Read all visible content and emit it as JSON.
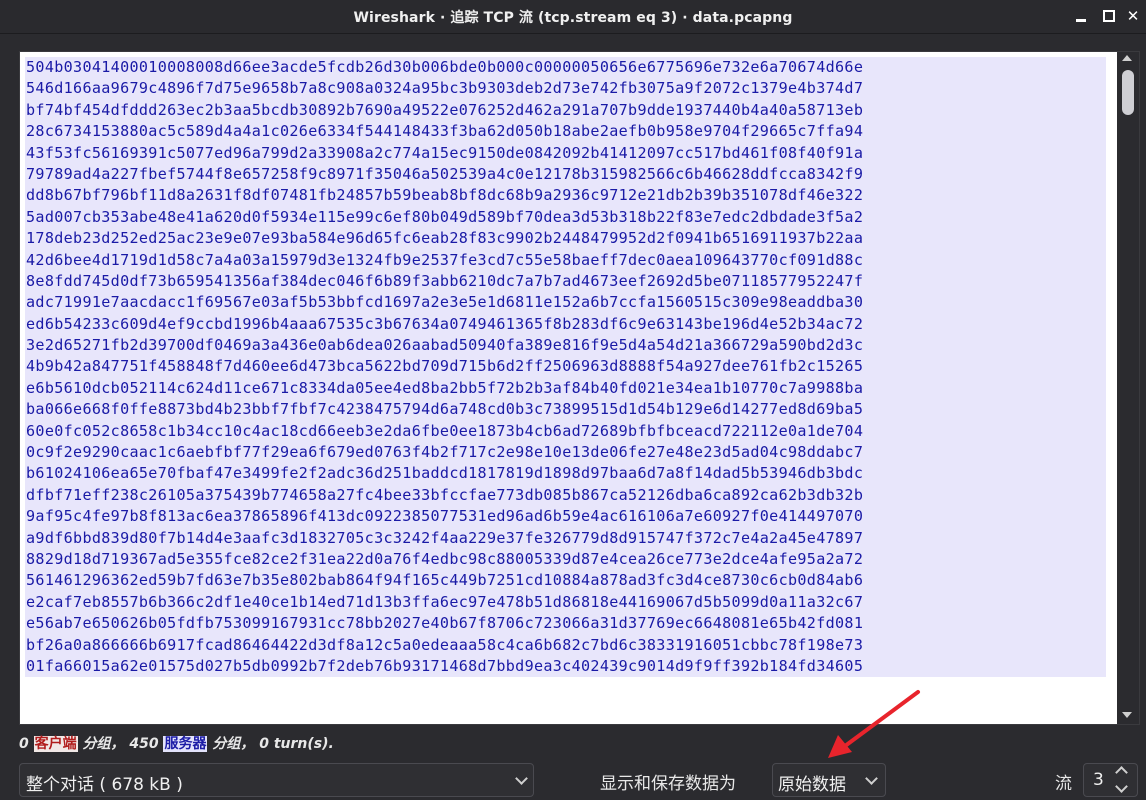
{
  "window": {
    "title": "Wireshark · 追踪 TCP 流 (tcp.stream eq 3) · data.pcapng",
    "min_glyph": "—",
    "max_glyph": "□",
    "close_glyph": "✕"
  },
  "stream": {
    "lines": [
      "504b03041400010008008d66ee3acde5fcdb26d30b006bde0b000c00000050656e6775696e732e6a70674d66e",
      "546d166aa9679c4896f7d75e9658b7a8c908a0324a95bc3b9303deb2d73e742fb3075a9f2072c1379e4b374d7",
      "bf74bf454dfddd263ec2b3aa5bcdb30892b7690a49522e076252d462a291a707b9dde1937440b4a40a58713eb",
      "28c6734153880ac5c589d4a4a1c026e6334f544148433f3ba62d050b18abe2aefb0b958e9704f29665c7ffa94",
      "43f53fc56169391c5077ed96a799d2a33908a2c774a15ec9150de0842092b41412097cc517bd461f08f40f91a",
      "79789ad4a227fbef5744f8e657258f9c8971f35046a502539a4c0e12178b315982566c6b46628ddfcca8342f9",
      "dd8b67bf796bf11d8a2631f8df07481fb24857b59beab8bf8dc68b9a2936c9712e21db2b39b351078df46e322",
      "5ad007cb353abe48e41a620d0f5934e115e99c6ef80b049d589bf70dea3d53b318b22f83e7edc2dbdade3f5a2",
      "178deb23d252ed25ac23e9e07e93ba584e96d65fc6eab28f83c9902b2448479952d2f0941b6516911937b22aa",
      "42d6bee4d1719d1d58c7a4a03a15979d3e1324fb9e2537fe3cd7c55e58baeff7dec0aea109643770cf091d88c",
      "8e8fdd745d0df73b659541356af384dec046f6b89f3abb6210dc7a7b7ad4673eef2692d5be07118577952247f",
      "adc71991e7aacdacc1f69567e03af5b53bbfcd1697a2e3e5e1d6811e152a6b7ccfa1560515c309e98eaddba30",
      "ed6b54233c609d4ef9ccbd1996b4aaa67535c3b67634a0749461365f8b283df6c9e63143be196d4e52b34ac72",
      "3e2d65271fb2d39700df0469a3a436e0ab6dea026aabad50940fa389e816f9e5d4a54d21a366729a590bd2d3c",
      "4b9b42a847751f458848f7d460ee6d473bca5622bd709d715b6d2ff2506963d8888f54a927dee761fb2c15265",
      "e6b5610dcb052114c624d11ce671c8334da05ee4ed8ba2bb5f72b2b3af84b40fd021e34ea1b10770c7a9988ba",
      "ba066e668f0ffe8873bd4b23bbf7fbf7c4238475794d6a748cd0b3c73899515d1d54b129e6d14277ed8d69ba5",
      "60e0fc052c8658c1b34cc10c4ac18cd66eeb3e2da6fbe0ee1873b4cb6ad72689bfbfbceacd722112e0a1de704",
      "0c9f2e9290caac1c6aebfbf77f29ea6f679ed0763f4b2f717c2e98e10e13de06fe27e48e23d5ad04c98ddabc7",
      "b61024106ea65e70fbaf47e3499fe2f2adc36d251baddcd1817819d1898d97baa6d7a8f14dad5b53946db3bdc",
      "dfbf71eff238c26105a375439b774658a27fc4bee33bfccfae773db085b867ca52126dba6ca892ca62b3db32b",
      "9af95c4fe97b8f813ac6ea37865896f413dc0922385077531ed96ad6b59e4ac616106a7e60927f0e414497070",
      "a9df6bbd839d80f7b14d4e3aafc3d1832705c3c3242f4aa229e37fe326779d8d915747f372c7e4a2a45e47897",
      "8829d18d719367ad5e355fce82ce2f31ea22d0a76f4edbc98c88005339d87e4cea26ce773e2dce4afe95a2a72",
      "561461296362ed59b7fd63e7b35e802bab864f94f165c449b7251cd10884a878ad3fc3d4ce8730c6cb0d84ab6",
      "e2caf7eb8557b6b366c2df1e40ce1b14ed71d13b3ffa6ec97e478b51d86818e44169067d5b5099d0a11a32c67",
      "e56ab7e650626b05fdfb753099167931cc78bb2027e40b67f8706c723066a31d37769ec6648081e65b42fd081",
      "bf26a0a866666b6917fcad86464422d3df8a12c5a0edeaaa58c4ca6b682c7bd6c38331916051cbbc78f198e73",
      "01fa66015a62e01575d027b5db0992b7f2deb76b93171468d7bbd9ea3c402439c9014d9f9ff392b184fd34605"
    ]
  },
  "status": {
    "client_count": "0",
    "client_label": "客户端",
    "packets_word_1": "分组，",
    "server_count": "450",
    "server_label": "服务器",
    "packets_word_2": "分组，",
    "turns": "0 turn(s)."
  },
  "controls": {
    "conversation_select": "整个对话 ( 678 kB )",
    "show_save_label": "显示和保存数据为",
    "format_select": "原始数据",
    "stream_label": "流",
    "stream_value": "3"
  },
  "colors": {
    "client_highlight": "#b01c1c",
    "server_highlight": "#1c1ca6",
    "hex_background": "#e8e6fb",
    "annotation_arrow": "#e8242c"
  },
  "icons": [
    "minimize-icon",
    "maximize-icon",
    "close-icon",
    "chevron-down-icon",
    "spin-up-icon",
    "spin-down-icon",
    "annotation-arrow-icon"
  ]
}
